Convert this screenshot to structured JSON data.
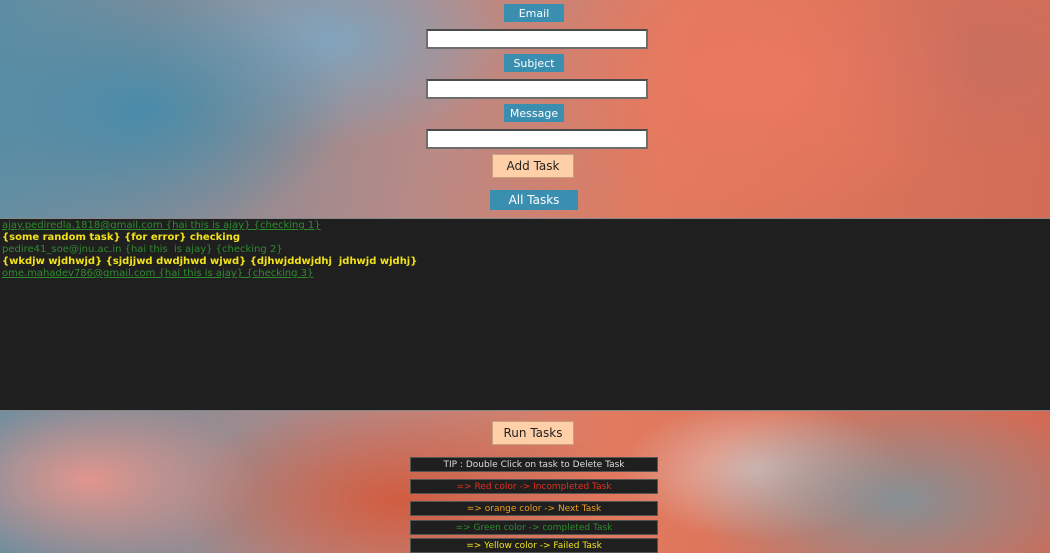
{
  "form": {
    "email_label": "Email",
    "email_value": "",
    "subject_label": "Subject",
    "subject_value": "",
    "message_label": "Message",
    "message_value": "",
    "add_task_label": "Add Task",
    "all_tasks_label": "All Tasks"
  },
  "tasks": [
    {
      "text": "ajay.pediredla.1818@gmail.com {hai this is ajay} {checking 1}",
      "color": "#2f8a2f"
    },
    {
      "text": "{some random task} {for error} checking",
      "color": "#f2e21a"
    },
    {
      "text": "pedire41_soe@jnu.ac.in {hai this  is ajay} {checking 2}",
      "color": "#2f8a2f"
    },
    {
      "text": "{wkdjw wjdhwjd} {sjdjjwd dwdjhwd wjwd} {djhwjddwjdhj  jdhwjd wjdhj}",
      "color": "#f2e21a"
    },
    {
      "text": "ome.mahadev786@gmail.com {hai this is ajay} {checking 3}",
      "color": "#2f8a2f"
    }
  ],
  "run_tasks_label": "Run Tasks",
  "legend": {
    "tip": "TIP : Double Click on task to Delete Task",
    "red": "=> Red color -> Incompleted Task",
    "orange": "=> orange color -> Next Task",
    "green": "=> Green color -> completed Task",
    "yellow": "=> Yellow color -> Failed Task"
  },
  "colors": {
    "accent_blue": "#3a8fb0",
    "peach_button": "#ffd0a8",
    "panel_bg": "#1f1f1f",
    "red": "#e0301e",
    "orange": "#f0a020",
    "green": "#2f8a2f",
    "yellow": "#f2e21a"
  }
}
